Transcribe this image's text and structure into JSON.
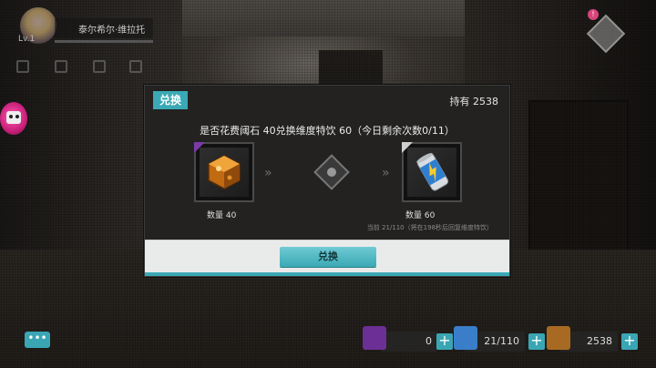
{
  "hud": {
    "player_level": "Lv.1",
    "player_name": "泰尔希尔·维拉托",
    "notification_count": "!",
    "chat_label": "•••"
  },
  "resources": [
    {
      "name": "dimension-stone",
      "value": "0",
      "color": "#7a3aa8"
    },
    {
      "name": "dimension-drink",
      "value": "21/110",
      "color": "#3a7ec9"
    },
    {
      "name": "treasure-chest",
      "value": "2538",
      "color": "#c9822a"
    }
  ],
  "dialog": {
    "title": "兑换",
    "holdings": "持有 2538",
    "question": "是否花费阈石 40兑换维度特饮 60（今日剩余次数0/11）",
    "input_item": {
      "name": "amber-crystal",
      "qty_label": "数量 40",
      "rarity_color": "#7a3aa8"
    },
    "output_item": {
      "name": "energy-drink-can",
      "qty_label": "数量 60",
      "rarity_color": "#cfcfcf"
    },
    "arrows": "»",
    "note": "当前 21/110（将在198秒后回复维度特饮）",
    "confirm_label": "兑换"
  },
  "colors": {
    "accent": "#3aa9b5",
    "dialog_bg": "#232221",
    "footer_bg": "#e9ebea"
  }
}
